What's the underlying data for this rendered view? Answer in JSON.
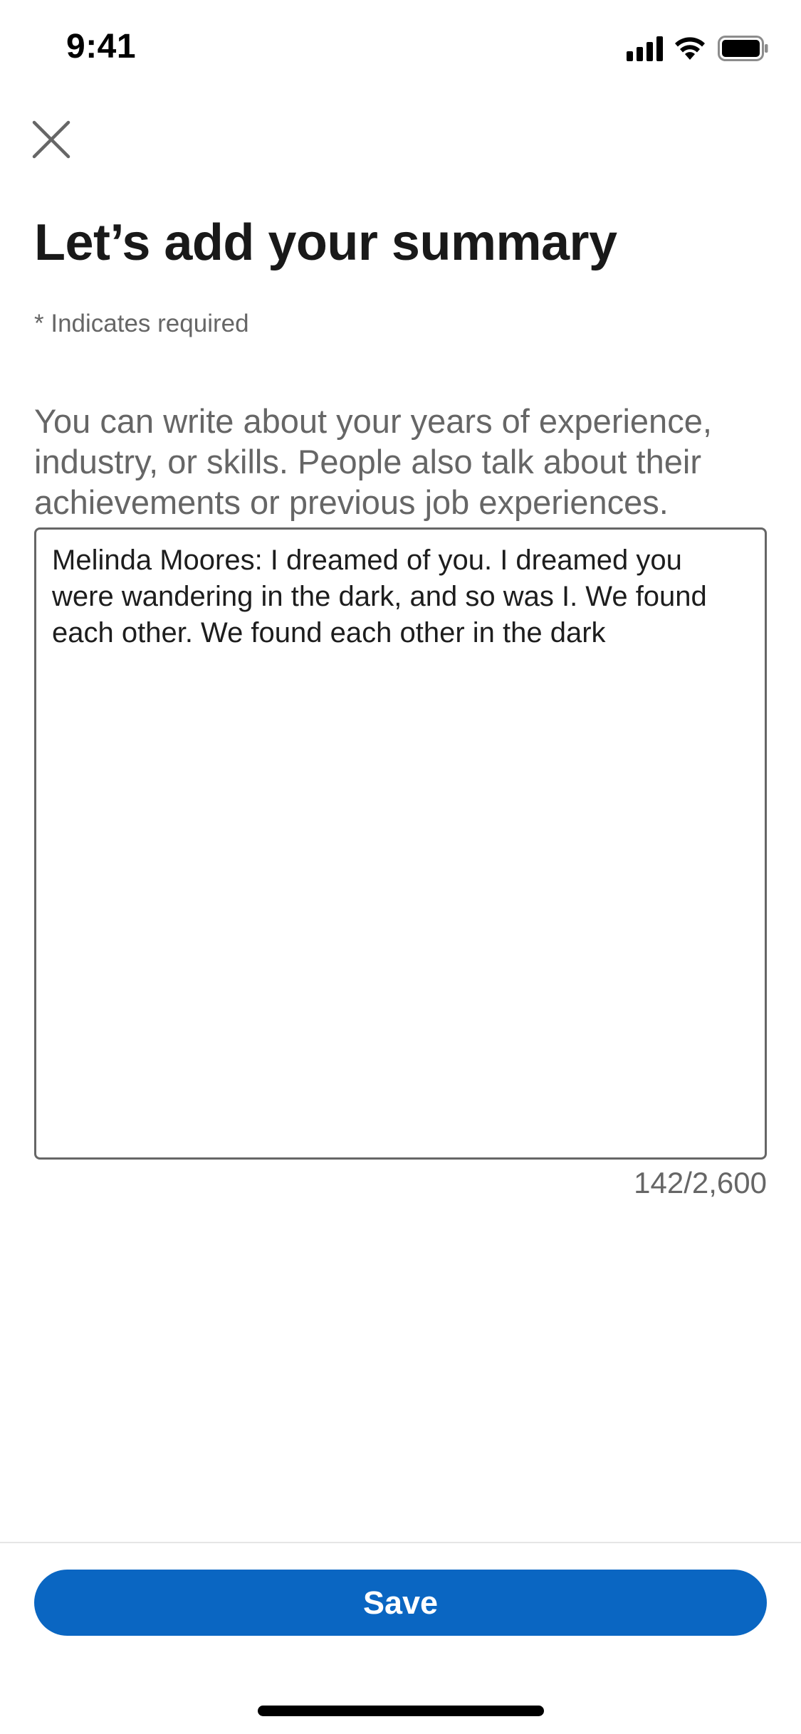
{
  "status_bar": {
    "time": "9:41"
  },
  "header": {
    "close_icon": "close-icon"
  },
  "form": {
    "title": "Let’s add your summary",
    "required_note": "* Indicates required",
    "help_text": "You can write about your years of experience, industry, or skills. People also talk about their achievements or previous job experiences.",
    "summary_value": "Melinda Moores: I dreamed of you. I dreamed you were wandering in the dark, and so was I. We found each other. We found each other in the dark",
    "char_count": "142/2,600"
  },
  "footer": {
    "save_label": "Save"
  },
  "colors": {
    "brand_primary": "#0a66c2",
    "text_primary": "#191919",
    "text_secondary": "#666666",
    "border": "#666666",
    "background": "#ffffff"
  },
  "icons": {
    "status": [
      "signal-icon",
      "wifi-icon",
      "battery-icon"
    ]
  }
}
